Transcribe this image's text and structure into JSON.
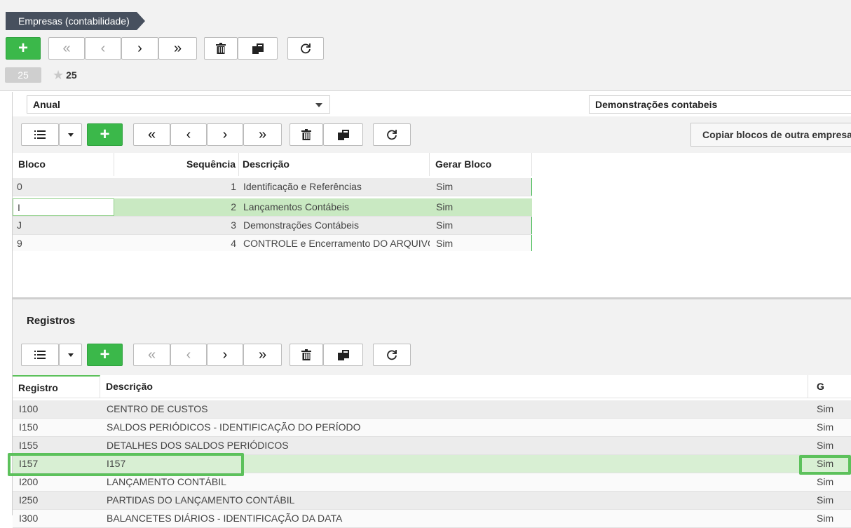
{
  "header": {
    "breadcrumb": "Empresas (contabilidade)",
    "record_count": "25",
    "favorites_count": "25"
  },
  "filters": {
    "period": "Anual",
    "report": "Demonstrações contabeis"
  },
  "blocks_toolbar": {
    "copy_button": "Copiar blocos de outra empresa"
  },
  "blocks_grid": {
    "columns": [
      "Bloco",
      "Sequência",
      "Descrição",
      "Gerar Bloco"
    ],
    "rows": [
      {
        "bloco": "0",
        "seq": "1",
        "desc": "Identificação e Referências",
        "gerar": "Sim"
      },
      {
        "bloco": "I",
        "seq": "2",
        "desc": "Lançamentos Contábeis",
        "gerar": "Sim"
      },
      {
        "bloco": "J",
        "seq": "3",
        "desc": "Demonstrações Contábeis",
        "gerar": "Sim"
      },
      {
        "bloco": "9",
        "seq": "4",
        "desc": "CONTROLE e Encerramento DO ARQUIVO DIGITAL",
        "gerar": "Sim"
      }
    ]
  },
  "registros": {
    "title": "Registros",
    "columns": [
      "Registro",
      "Descrição",
      "G"
    ],
    "rows": [
      {
        "reg": "I100",
        "desc": "CENTRO DE CUSTOS",
        "g": "Sim"
      },
      {
        "reg": "I150",
        "desc": "SALDOS PERIÓDICOS - IDENTIFICAÇÃO DO PERÍODO",
        "g": "Sim"
      },
      {
        "reg": "I155",
        "desc": "DETALHES DOS SALDOS PERIÓDICOS",
        "g": "Sim"
      },
      {
        "reg": "I157",
        "desc": "I157",
        "g": "Sim"
      },
      {
        "reg": "I200",
        "desc": "LANÇAMENTO CONTÁBIL",
        "g": "Sim"
      },
      {
        "reg": "I250",
        "desc": "PARTIDAS DO LANÇAMENTO CONTÁBIL",
        "g": "Sim"
      },
      {
        "reg": "I300",
        "desc": "BALANCETES DIÁRIOS - IDENTIFICAÇÃO DA DATA",
        "g": "Sim"
      }
    ]
  },
  "colors": {
    "accent_green": "#3bb84a",
    "highlight_green": "#5cc15b",
    "selected_row": "#c9e9c2",
    "breadcrumb_bg": "#47505e"
  }
}
